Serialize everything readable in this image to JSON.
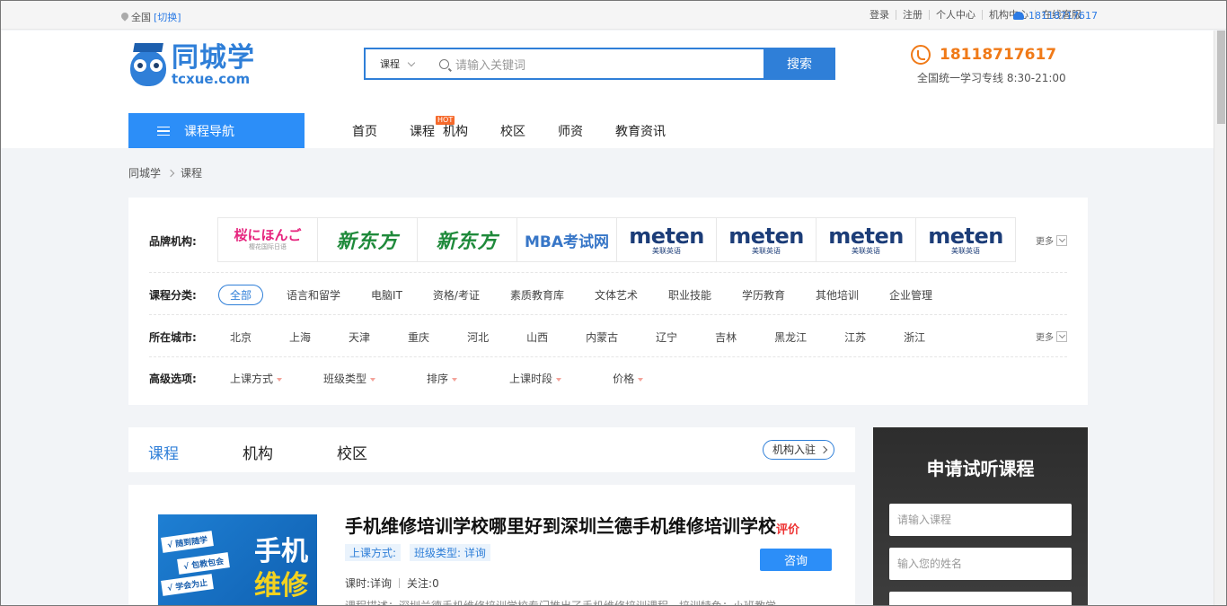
{
  "topbar": {
    "location": "全国",
    "switch": "[切换]",
    "links": [
      "登录",
      "注册",
      "个人中心",
      "机构中心",
      "在线客服"
    ],
    "phone": "18118717617"
  },
  "header": {
    "logo_cn": "同城学",
    "logo_en": "tcxue.com",
    "search_category": "课程",
    "search_placeholder": "请输入关键词",
    "search_button": "搜索",
    "hotline_number": "18118717617",
    "hotline_sub": "全国统一学习专线 8:30-21:00"
  },
  "nav": {
    "category_button": "课程导航",
    "links": [
      "首页",
      "课程",
      "机构",
      "校区",
      "师资",
      "教育资讯"
    ],
    "hot_badge": "HOT"
  },
  "breadcrumb": [
    "同城学",
    "课程"
  ],
  "filter": {
    "brand_label": "品牌机构:",
    "brands": [
      {
        "name": "桜にほんご",
        "sub": "樱花国际日语"
      },
      {
        "name": "新东方"
      },
      {
        "name": "新东方"
      },
      {
        "name": "MBA考试网"
      },
      {
        "name": "meten",
        "sub": "美联英语"
      },
      {
        "name": "meten",
        "sub": "美联英语"
      },
      {
        "name": "meten",
        "sub": "美联英语"
      },
      {
        "name": "meten",
        "sub": "美联英语"
      }
    ],
    "more": "更多",
    "category_label": "课程分类:",
    "categories": [
      "全部",
      "语言和留学",
      "电脑IT",
      "资格/考证",
      "素质教育库",
      "文体艺术",
      "职业技能",
      "学历教育",
      "其他培训",
      "企业管理"
    ],
    "city_label": "所在城市:",
    "cities": [
      "北京",
      "上海",
      "天津",
      "重庆",
      "河北",
      "山西",
      "内蒙古",
      "辽宁",
      "吉林",
      "黑龙江",
      "江苏",
      "浙江"
    ],
    "advanced_label": "高级选项:",
    "advanced": [
      "上课方式",
      "班级类型",
      "排序",
      "上课时段",
      "价格"
    ]
  },
  "tabs": {
    "items": [
      "课程",
      "机构",
      "校区"
    ],
    "join": "机构入驻"
  },
  "course": {
    "thumb_tags": [
      "√ 随到随学",
      "√ 包教包会",
      "√ 学会为止"
    ],
    "thumb_big_1": "手机",
    "thumb_big_2": "维修",
    "title": "手机维修培训学校哪里好到深圳兰德手机维修培训学校",
    "rating": "评价",
    "mode": "上课方式:",
    "class_type": "班级类型: 详询",
    "hours": "课时:详询",
    "follow": "关注:0",
    "consult": "咨询",
    "desc": "课程描述：深圳兰德手机维修培训学校专门推出了手机维修培训课程，培训特色：小班教学 ..."
  },
  "side": {
    "title": "申请试听课程",
    "course_placeholder": "请输入课程",
    "name_placeholder": "输入您的姓名"
  }
}
